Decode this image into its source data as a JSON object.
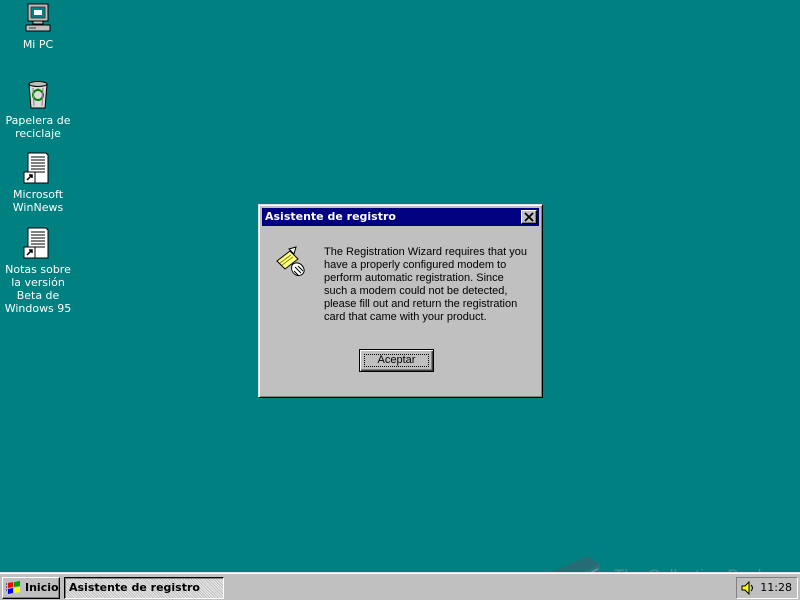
{
  "desktop": {
    "icons": [
      {
        "label": "Mi PC",
        "icon": "my-computer-icon"
      },
      {
        "label": "Papelera de reciclaje",
        "icon": "recycle-bin-icon"
      },
      {
        "label": "Microsoft WinNews",
        "icon": "document-shortcut-icon"
      },
      {
        "label": "Notas sobre la versión Beta de Windows 95",
        "icon": "document-shortcut-icon"
      }
    ]
  },
  "dialog": {
    "title": "Asistente de registro",
    "close_label": "✕",
    "message": "The Registration Wizard requires that you have a properly configured modem to perform automatic registration.  Since such a modem could not be detected, please fill out and return the registration card that came with your product.",
    "ok_label": "Aceptar"
  },
  "taskbar": {
    "start_label": "Inicio",
    "task_label": "Asistente de registro",
    "clock": "11:28"
  },
  "watermark": {
    "text": "The Collection Book"
  },
  "colors": {
    "desktop": "#008080",
    "titlebar": "#000080",
    "face": "#c0c0c0"
  }
}
